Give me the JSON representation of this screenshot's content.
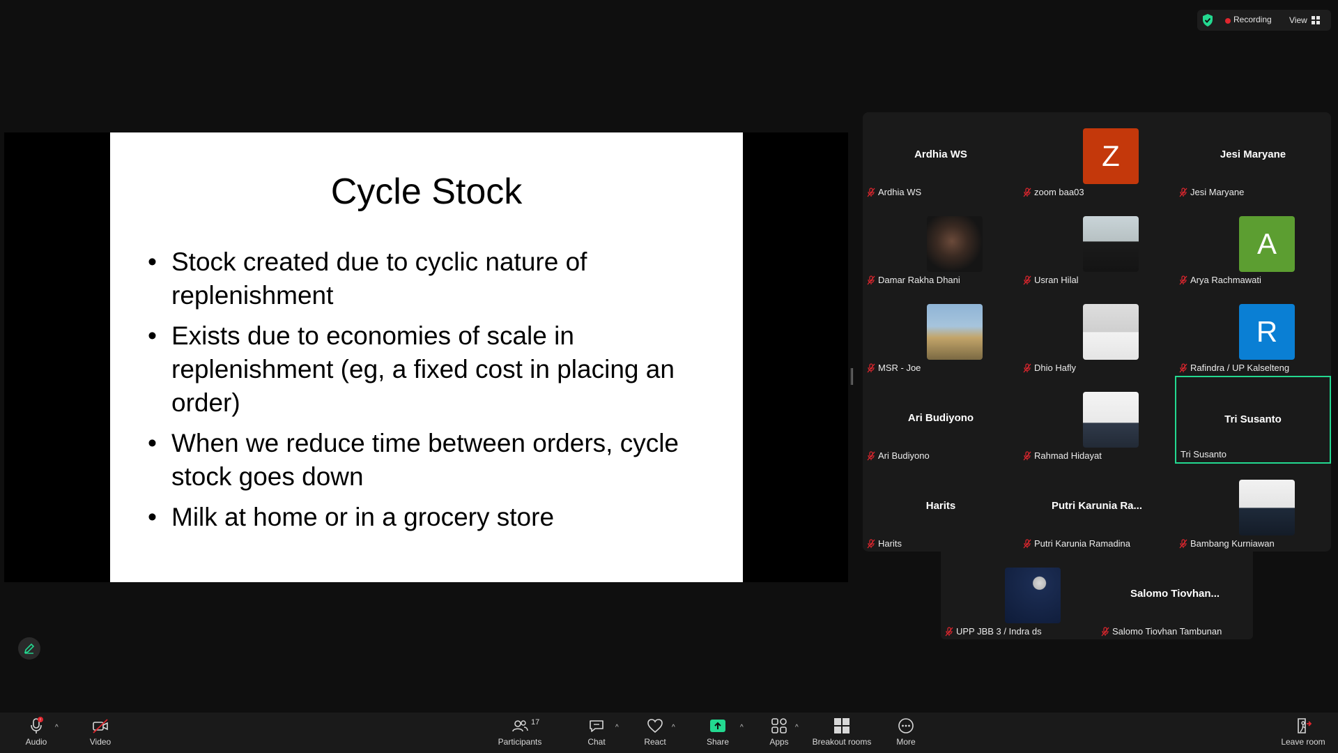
{
  "status": {
    "recording_label": "Recording",
    "view_label": "View"
  },
  "slide": {
    "title": "Cycle Stock",
    "bullets": [
      "Stock created due to cyclic nature of replenishment",
      "Exists due to economies of scale in replenishment (eg, a fixed cost in placing an order)",
      "When we reduce time between orders, cycle stock goes down",
      "Milk at home or in a grocery store"
    ]
  },
  "participants": [
    {
      "label": "Ardhia WS",
      "center_name": "Ardhia WS"
    },
    {
      "label": "zoom baa03",
      "avatar_letter": "Z",
      "avatar_color": "#c4380b"
    },
    {
      "label": "Jesi Maryane",
      "center_name": "Jesi Maryane"
    },
    {
      "label": "Damar Rakha Dhani",
      "avatar_photo": "photo"
    },
    {
      "label": "Usran Hilal",
      "avatar_photo": "photo"
    },
    {
      "label": "Arya Rachmawati",
      "avatar_letter": "A",
      "avatar_color": "#5c9e31"
    },
    {
      "label": "MSR - Joe",
      "avatar_photo": "photo"
    },
    {
      "label": "Dhio Hafly",
      "avatar_photo": "photo"
    },
    {
      "label": "Rafindra / UP Kalselteng",
      "avatar_letter": "R",
      "avatar_color": "#0a7fd4"
    },
    {
      "label": "Ari Budiyono",
      "center_name": "Ari Budiyono"
    },
    {
      "label": "Rahmad Hidayat",
      "avatar_photo": "photo"
    },
    {
      "label": "Tri Susanto",
      "center_name": "Tri Susanto",
      "active": true
    },
    {
      "label": "Harits",
      "center_name": "Harits"
    },
    {
      "label": "Putri Karunia Ramadina",
      "center_name": "Putri  Karunia  Ra..."
    },
    {
      "label": "Bambang Kurniawan",
      "avatar_photo": "photo"
    },
    {
      "label": "UPP JBB 3 / Indra ds",
      "avatar_photo": "photo"
    },
    {
      "label": "Salomo Tiovhan Tambunan",
      "center_name": "Salomo  Tiovhan..."
    }
  ],
  "toolbar": {
    "audio": "Audio",
    "video": "Video",
    "participants": "Participants",
    "participants_count": "17",
    "chat": "Chat",
    "react": "React",
    "share": "Share",
    "apps": "Apps",
    "breakout": "Breakout rooms",
    "more": "More",
    "leave": "Leave room",
    "caret": "^"
  },
  "colors": {
    "active_speaker": "#23d990",
    "share_green": "#23d990",
    "muted_red": "#e0262e"
  }
}
